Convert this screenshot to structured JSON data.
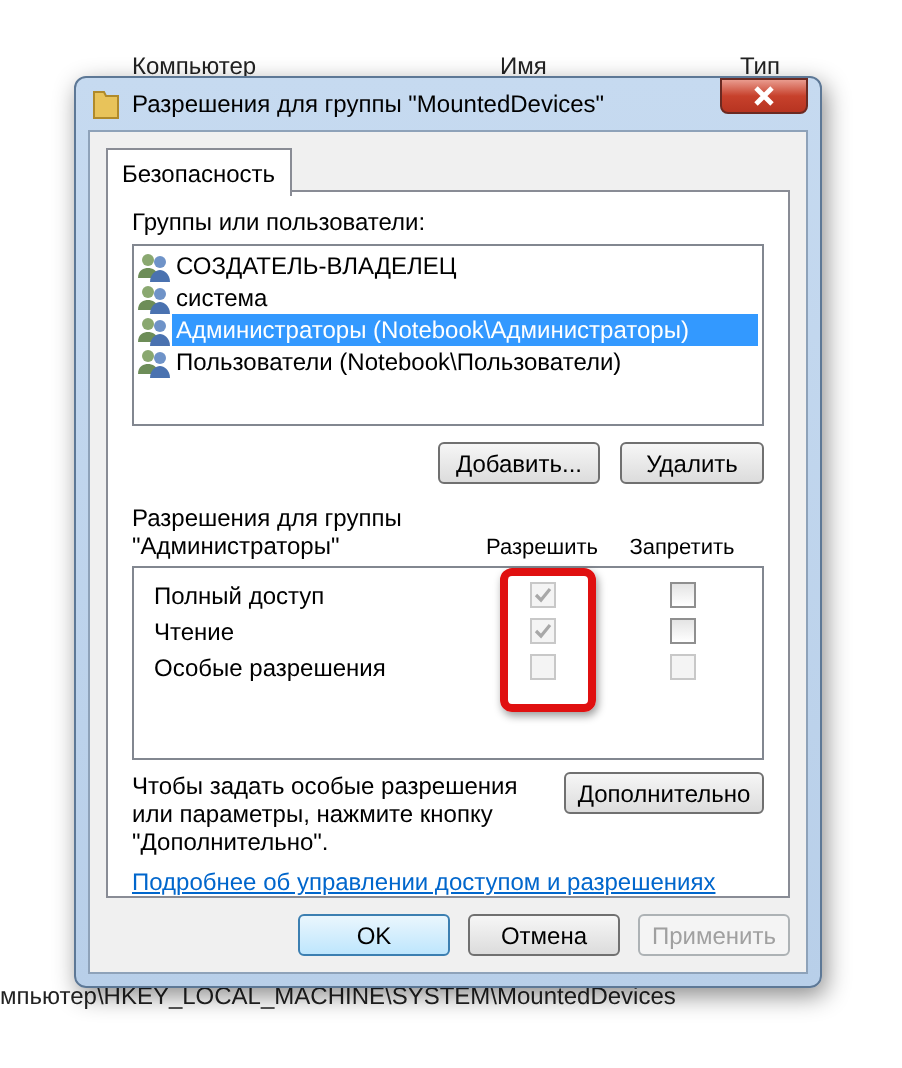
{
  "background_window": {
    "breadcrumb": "Компьютер",
    "columns": [
      "Имя",
      "Тип"
    ],
    "path": "мпьютер\\HKEY_LOCAL_MACHINE\\SYSTEM\\MountedDevices"
  },
  "window": {
    "title": "Разрешения для группы \"MountedDevices\""
  },
  "tabs": [
    {
      "label": "Безопасность",
      "selected": true
    }
  ],
  "groups_label": "Группы или пользователи:",
  "groups": [
    {
      "name": "СОЗДАТЕЛЬ-ВЛАДЕЛЕЦ",
      "selected": false
    },
    {
      "name": "система",
      "selected": false
    },
    {
      "name": "Администраторы (Notebook\\Администраторы)",
      "selected": true
    },
    {
      "name": "Пользователи (Notebook\\Пользователи)",
      "selected": false
    }
  ],
  "group_buttons": [
    "Добавить...",
    "Удалить"
  ],
  "permissions_label": "Разрешения для группы \"Администраторы\"",
  "permission_columns": [
    "Разрешить",
    "Запретить"
  ],
  "permissions": [
    {
      "name": "Полный доступ",
      "allow_checked": true,
      "allow_disabled": true,
      "deny_checked": false,
      "deny_disabled": false
    },
    {
      "name": "Чтение",
      "allow_checked": true,
      "allow_disabled": true,
      "deny_checked": false,
      "deny_disabled": false
    },
    {
      "name": "Особые разрешения",
      "allow_checked": false,
      "allow_disabled": true,
      "deny_checked": false,
      "deny_disabled": true
    }
  ],
  "advanced_hint": "Чтобы задать особые разрешения или параметры, нажмите кнопку \"Дополнительно\".",
  "advanced_button": "Дополнительно",
  "help_link": "Подробнее об управлении доступом и разрешениях",
  "dialog_buttons": [
    {
      "label": "OK",
      "kind": "default",
      "disabled": false
    },
    {
      "label": "Отмена",
      "kind": "normal",
      "disabled": false
    },
    {
      "label": "Применить",
      "kind": "normal",
      "disabled": true
    }
  ]
}
